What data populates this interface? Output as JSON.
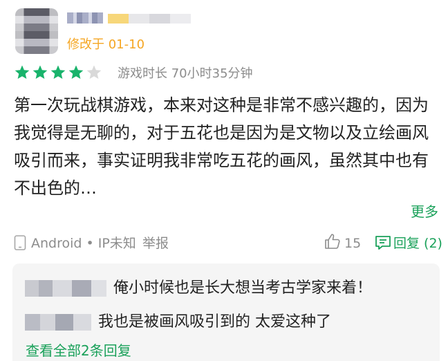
{
  "review": {
    "modified_text": "修改于 01-10",
    "rating": 4,
    "rating_max": 5,
    "playtime": "游戏时长 70小时35分钟",
    "content": "第一次玩战棋游戏，本来对这种是非常不感兴趣的，因为我觉得是无聊的，对于五花也是因为是文物以及立绘画风吸引而来，事实证明我非常吃五花的画风，虽然其中也有不出色的…",
    "more_label": "更多",
    "device_text": "Android • IP未知",
    "report_label": "举报",
    "like_count": "15",
    "reply_label": "回复 (2)"
  },
  "replies": {
    "items": [
      {
        "text": "俺小时候也是长大想当考古学家来着！"
      },
      {
        "text": "我也是被画风吸引到的 太爱这种了"
      }
    ],
    "view_all_label": "查看全部2条回复"
  },
  "colors": {
    "accent_green": "#1aa15a",
    "star_filled": "#19b36b",
    "star_empty": "#d9d9d9",
    "modified_orange": "#f5a623",
    "meta_gray": "#8c8c8c"
  },
  "icons": {
    "rating": "star-icon",
    "device": "phone-icon",
    "like": "thumbs-up-icon",
    "reply": "comment-icon"
  }
}
